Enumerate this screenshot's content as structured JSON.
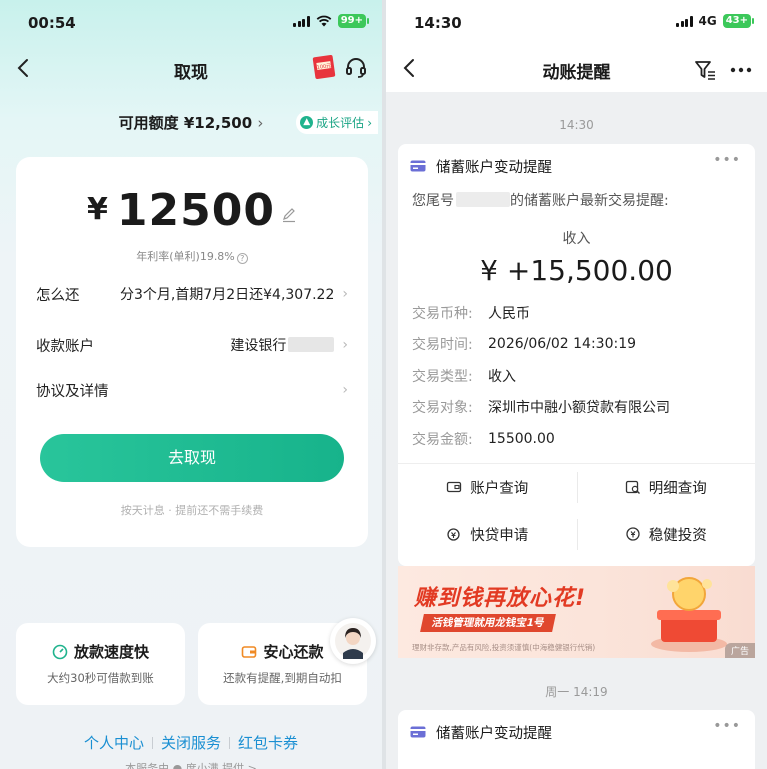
{
  "left": {
    "status": {
      "time": "00:54",
      "battery": "99+"
    },
    "nav": {
      "title": "取现"
    },
    "quota": {
      "label": "可用额度 ¥12,500",
      "growth": "成长评估"
    },
    "gift_icon_text": "100元",
    "card": {
      "currency": "¥",
      "amount": "12500",
      "rate": "年利率(单利)19.8%",
      "rows": [
        {
          "label": "怎么还",
          "value": "分3个月,首期7月2日还¥4,307.22"
        },
        {
          "label": "收款账户",
          "value": "建设银行"
        },
        {
          "label": "协议及详情",
          "value": ""
        }
      ],
      "button": "去取现",
      "note": "按天计息 · 提前还不需手续费"
    },
    "features": [
      {
        "title": "放款速度快",
        "desc": "大约30秒可借款到账"
      },
      {
        "title": "安心还款",
        "desc": "还款有提醒,到期自动扣"
      }
    ],
    "links": [
      "个人中心",
      "关闭服务",
      "红包卡券"
    ],
    "provider": "本服务由 ● 度小满 提供 >"
  },
  "right": {
    "status": {
      "time": "14:30",
      "network": "4G",
      "battery": "43+"
    },
    "nav": {
      "title": "动账提醒"
    },
    "timestamp1": "14:30",
    "message": {
      "title": "储蓄账户变动提醒",
      "intro_prefix": "您尾号",
      "intro_suffix": "的储蓄账户最新交易提醒:",
      "type": "收入",
      "amount": "¥ +15,500.00",
      "fields": [
        {
          "key": "交易币种:",
          "value": "人民币"
        },
        {
          "key": "交易时间:",
          "value": "2026/06/02 14:30:19"
        },
        {
          "key": "交易类型:",
          "value": "收入"
        },
        {
          "key": "交易对象:",
          "value": "深圳市中融小额贷款有限公司"
        },
        {
          "key": "交易金额:",
          "value": "15500.00"
        }
      ],
      "actions": [
        "账户查询",
        "明细查询",
        "快贷申请",
        "稳健投资"
      ]
    },
    "banner": {
      "title": "赚到钱再放心花!",
      "subtitle": "活钱管理就用龙钱宝1号",
      "fine": "理财非存款,产品有风险,投资须谨慎(中海稳健银行代销)",
      "ad": "广告"
    },
    "timestamp2": "周一 14:19",
    "message2_title": "储蓄账户变动提醒"
  },
  "colors": {
    "accent_green": "#1fb38d",
    "link_blue": "#1a8fd2",
    "banner_red": "#e23a23"
  }
}
